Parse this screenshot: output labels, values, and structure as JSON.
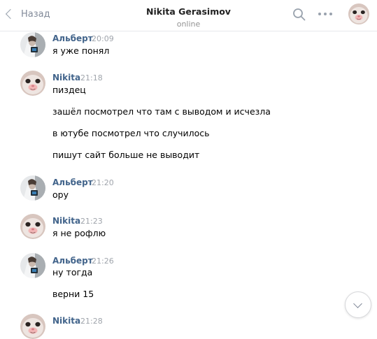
{
  "header": {
    "back_label": "Назад",
    "title": "Nikita Gerasimov",
    "status": "online",
    "icons": [
      "chevron-left-icon",
      "search-icon",
      "more-icon"
    ]
  },
  "messages": [
    {
      "author": "Альберт",
      "time": "20:09",
      "lines": [
        "я уже понял"
      ]
    },
    {
      "author": "Nikita",
      "time": "21:18",
      "lines": [
        "пиздец",
        "зашёл посмотрел что там с выводом и исчезла",
        "в ютубе посмотрел что случилось",
        "пишут сайт больше не выводит"
      ]
    },
    {
      "author": "Альберт",
      "time": "21:20",
      "lines": [
        "ору"
      ]
    },
    {
      "author": "Nikita",
      "time": "21:23",
      "lines": [
        "я не рофлю"
      ]
    },
    {
      "author": "Альберт",
      "time": "21:26",
      "lines": [
        "ну тогда",
        "верни 15"
      ]
    },
    {
      "author": "Nikita",
      "time": "21:28",
      "lines": []
    }
  ],
  "colors": {
    "author_name": "#42648b",
    "timestamp": "#a0a5ac",
    "icon": "#99a2ad",
    "divider": "#e7e8ec"
  },
  "scroll_button_icon": "chevron-down-icon"
}
